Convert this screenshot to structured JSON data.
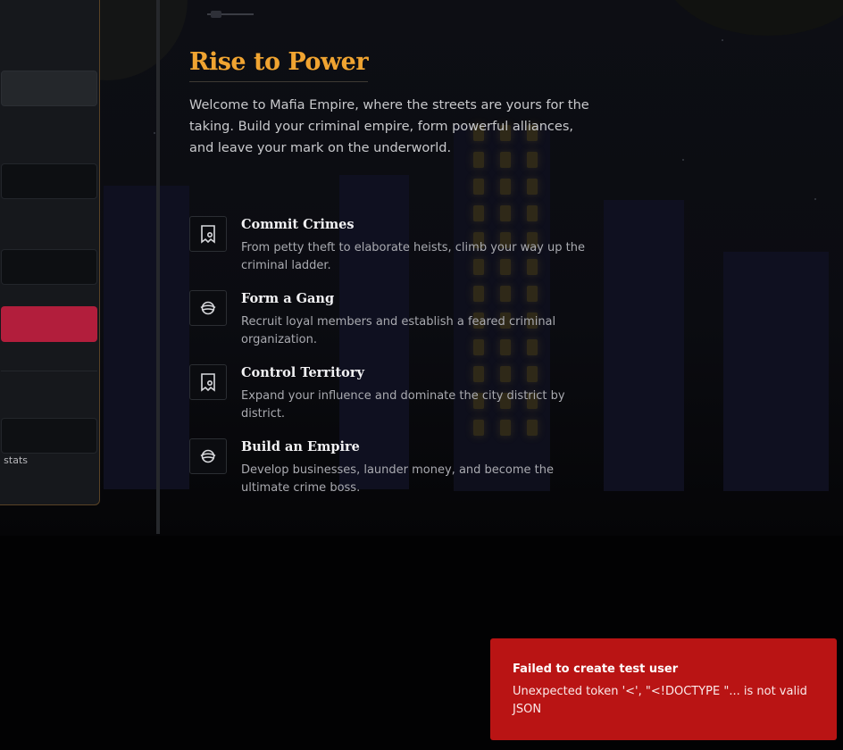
{
  "hero": {
    "title": "Rise to Power",
    "intro": "Welcome to Mafia Empire, where the streets are yours for the taking. Build your criminal empire, form powerful alliances, and leave your mark on the underworld."
  },
  "features": [
    {
      "icon": "vault-icon",
      "title": "Commit Crimes",
      "description": "From petty theft to elaborate heists, climb your way up the criminal ladder."
    },
    {
      "icon": "planet-icon",
      "title": "Form a Gang",
      "description": "Recruit loyal members and establish a feared criminal organization."
    },
    {
      "icon": "vault-icon",
      "title": "Control Territory",
      "description": "Expand your influence and dominate the city district by district."
    },
    {
      "icon": "planet-icon",
      "title": "Build an Empire",
      "description": "Develop businesses, launder money, and become the ultimate crime boss."
    }
  ],
  "auth_panel": {
    "note_fragment": "l stats"
  },
  "toast": {
    "title": "Failed to create test user",
    "message": "Unexpected token '<', \"<!DOCTYPE \"... is not valid JSON",
    "color": "#b91414"
  },
  "colors": {
    "accent": "#f0a431",
    "submit": "#b21e3c"
  }
}
